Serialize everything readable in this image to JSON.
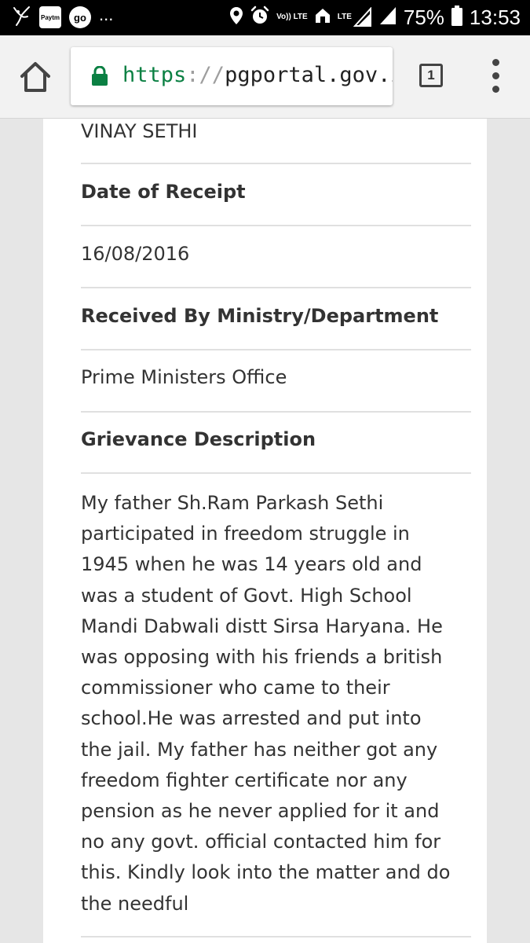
{
  "status_bar": {
    "apps": [
      "Paytm",
      "go"
    ],
    "more": "...",
    "network": "Vo)) LTE",
    "data": "LTE",
    "battery": "75%",
    "time": "13:53"
  },
  "browser": {
    "url_scheme": "https",
    "url_separator": "://",
    "url_host": "pgportal.gov.in",
    "tab_count": "1"
  },
  "grievance": {
    "name_value": "VINAY SETHI",
    "date_label": "Date of Receipt",
    "date_value": "16/08/2016",
    "received_by_label": "Received By Ministry/Department",
    "received_by_value": "Prime Ministers Office",
    "description_label": "Grievance Description",
    "description_lines": [
      "My father Sh.Ram Parkash Sethi",
      "participated in freedom struggle in",
      "1945 when he was 14 years old and",
      "was a student of Govt. High School",
      "Mandi Dabwali distt Sirsa Haryana. He",
      "was opposing with his friends a british",
      "commissioner who came to their",
      "school.He was arrested and put into",
      "the jail. My father has neither got any",
      "freedom fighter certificate nor any",
      "pension as he never applied for it and",
      "no any govt. official contacted him for",
      "this. Kindly look into the matter and do",
      "the needful"
    ]
  },
  "icons": {
    "status_left": [
      "hummingbird-icon",
      "paytm-icon",
      "go-icon"
    ],
    "status_right": [
      "location-icon",
      "alarm-icon",
      "volte-icon",
      "home-notification-icon",
      "lte-signal-icon",
      "cell-signal-icon",
      "battery-icon"
    ],
    "toolbar": [
      "home-icon",
      "lock-icon",
      "tab-switcher-icon",
      "overflow-menu-icon"
    ]
  },
  "colors": {
    "url_scheme": "#0b8043",
    "lock": "#0b8043",
    "status_bar": "#000000",
    "toolbar": "#f2f2f2",
    "divider": "#e0e0e0",
    "text": "#333333"
  }
}
